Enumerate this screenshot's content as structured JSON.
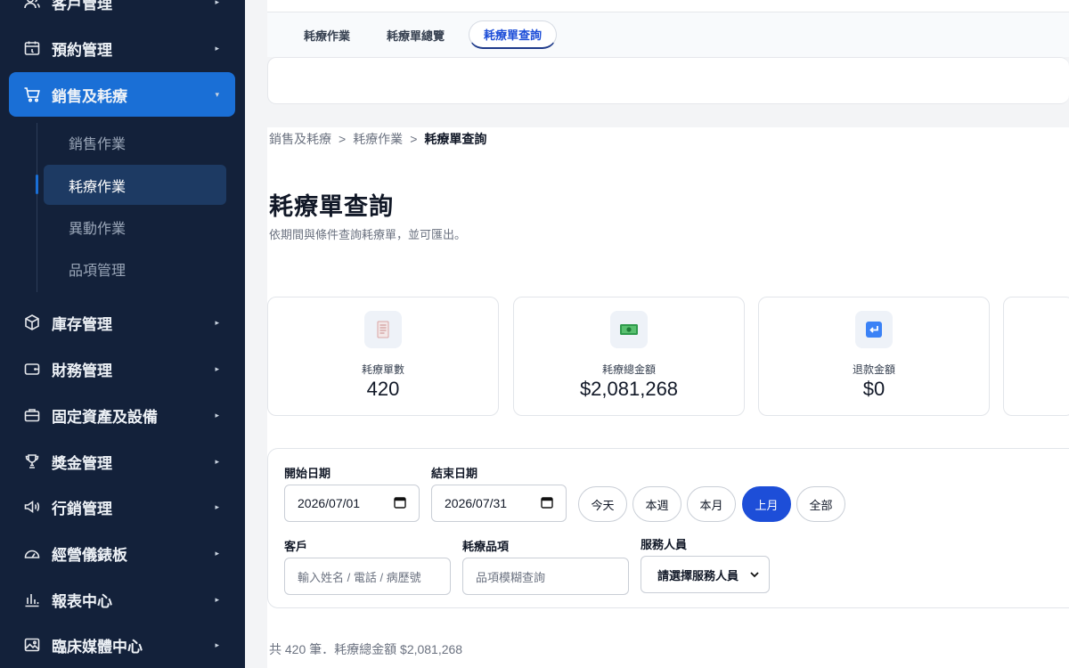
{
  "sidebar": {
    "items": [
      {
        "label": "客戶管理",
        "icon": "users-icon"
      },
      {
        "label": "預約管理",
        "icon": "calendar-icon"
      },
      {
        "label": "銷售及耗療",
        "icon": "cart-icon"
      },
      {
        "label": "庫存管理",
        "icon": "box-icon"
      },
      {
        "label": "財務管理",
        "icon": "wallet-icon"
      },
      {
        "label": "固定資產及設備",
        "icon": "briefcase-icon"
      },
      {
        "label": "獎金管理",
        "icon": "trophy-icon"
      },
      {
        "label": "行銷管理",
        "icon": "megaphone-icon"
      },
      {
        "label": "經營儀錶板",
        "icon": "gauge-icon"
      },
      {
        "label": "報表中心",
        "icon": "bar-chart-icon"
      },
      {
        "label": "臨床媒體中心",
        "icon": "image-icon"
      }
    ],
    "sub_items": [
      {
        "label": "銷售作業"
      },
      {
        "label": "耗療作業"
      },
      {
        "label": "異動作業"
      },
      {
        "label": "品項管理"
      }
    ]
  },
  "tabs": [
    {
      "label": "耗療作業"
    },
    {
      "label": "耗療單總覽"
    },
    {
      "label": "耗療單查詢"
    }
  ],
  "breadcrumb": {
    "level1": "銷售及耗療",
    "level2": "耗療作業",
    "current": "耗療單查詢",
    "separator": ">"
  },
  "page": {
    "title": "耗療單查詢",
    "description": "依期間與條件查詢耗療單，並可匯出。"
  },
  "stats": [
    {
      "label": "耗療單數",
      "value": "420",
      "icon": "receipt-icon"
    },
    {
      "label": "耗療總金額",
      "value": "$2,081,268",
      "icon": "money-icon"
    },
    {
      "label": "退款金額",
      "value": "$0",
      "icon": "return-arrow-icon"
    }
  ],
  "filters": {
    "start_label": "開始日期",
    "start_value": "2026/07/01",
    "end_label": "結束日期",
    "end_value": "2026/07/31",
    "quick_ranges": [
      {
        "label": "今天"
      },
      {
        "label": "本週"
      },
      {
        "label": "本月"
      },
      {
        "label": "上月"
      },
      {
        "label": "全部"
      }
    ],
    "customer_label": "客戶",
    "customer_placeholder": "輸入姓名 / 電話 / 病歷號",
    "item_label": "耗療品項",
    "item_placeholder": "品項模糊查詢",
    "staff_label": "服務人員",
    "staff_value": "請選擇服務人員"
  },
  "summary": "共 420 筆．耗療總金額 $2,081,268",
  "colors": {
    "sidebar_bg": "#13213a",
    "accent": "#1d4ed8",
    "active_nav": "#1a6fd6"
  }
}
